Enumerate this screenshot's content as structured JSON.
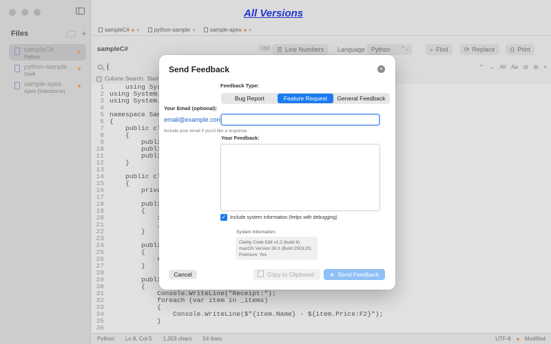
{
  "app": {
    "title": "All Versions"
  },
  "sidebar": {
    "header": "Files",
    "new_folder_icon": "folder-plus-icon",
    "add_icon": "+",
    "items": [
      {
        "name": "sampleC#",
        "lang": "Python",
        "modified": true,
        "active": true
      },
      {
        "name": "python-sample",
        "lang": "Swift",
        "modified": true,
        "active": false
      },
      {
        "name": "sample-apex",
        "lang": "Apex (Salesforce)",
        "modified": true,
        "active": false
      }
    ]
  },
  "tabs": [
    {
      "label": "sampleC#"
    },
    {
      "label": "python-sample"
    },
    {
      "label": "sample-apex"
    }
  ],
  "toolbar": {
    "document_name": "sampleC#",
    "font_size": "13pt",
    "line_numbers_label": "Line Numbers",
    "language_label": "Language",
    "language_value": "Python",
    "find_label": "Find",
    "replace_label": "Replace",
    "print_label": "Print"
  },
  "search": {
    "query": "{",
    "all_label": "All",
    "case_label": "Aa",
    "column_search_label": "Column Search:",
    "start_label": "Start:"
  },
  "code": [
    {
      "n": "1",
      "t": "    using Syst"
    },
    {
      "n": "2",
      "t": "using System.C"
    },
    {
      "n": "3",
      "t": "using System.L"
    },
    {
      "n": "4",
      "t": ""
    },
    {
      "n": "5",
      "t": "namespace Samp"
    },
    {
      "n": "6",
      "t": "{"
    },
    {
      "n": "7",
      "t": "    public cla"
    },
    {
      "n": "8",
      "t": "    {"
    },
    {
      "n": "9",
      "t": "        public"
    },
    {
      "n": "10",
      "t": "        public"
    },
    {
      "n": "11",
      "t": "        public"
    },
    {
      "n": "12",
      "t": "    }"
    },
    {
      "n": "13",
      "t": ""
    },
    {
      "n": "14",
      "t": "    public cla"
    },
    {
      "n": "15",
      "t": "    {"
    },
    {
      "n": "16",
      "t": "        privat"
    },
    {
      "n": "17",
      "t": ""
    },
    {
      "n": "18",
      "t": "        public"
    },
    {
      "n": "19",
      "t": "        {"
    },
    {
      "n": "20",
      "t": "            if"
    },
    {
      "n": "21",
      "t": "            _i"
    },
    {
      "n": "22",
      "t": "        }"
    },
    {
      "n": "23",
      "t": ""
    },
    {
      "n": "24",
      "t": "        public"
    },
    {
      "n": "25",
      "t": "        {"
    },
    {
      "n": "26",
      "t": "            re"
    },
    {
      "n": "27",
      "t": "        }"
    },
    {
      "n": "28",
      "t": ""
    },
    {
      "n": "29",
      "t": "        public"
    },
    {
      "n": "30",
      "t": "        {"
    },
    {
      "n": "31",
      "t": "            Console.WriteLine(\"Receipt:\");"
    },
    {
      "n": "32",
      "t": "            foreach (var item in _items)"
    },
    {
      "n": "33",
      "t": "            {"
    },
    {
      "n": "34",
      "t": "                Console.WriteLine($\"{item.Name} - ${item.Price:F2}\");"
    },
    {
      "n": "35",
      "t": "            }"
    },
    {
      "n": "36",
      "t": ""
    }
  ],
  "status": {
    "language": "Python",
    "position": "Ln 8, Col 5",
    "chars": "1,353 chars",
    "lines": "54 lines",
    "encoding": "UTF-8",
    "modified": "Modified"
  },
  "dialog": {
    "title": "Send Feedback",
    "feedback_type_label": "Feedback Type:",
    "types": [
      "Bug Report",
      "Feature Request",
      "General Feedback"
    ],
    "selected_type": "Feature Request",
    "email_label": "Your Email (optional):",
    "email_placeholder": "email@example.com",
    "email_value": "",
    "email_help": "Include your email if you'd like a response",
    "feedback_label": "Your Feedback:",
    "feedback_value": "",
    "include_sysinfo_label": "Include system information (helps with debugging)",
    "include_sysinfo_checked": true,
    "sysinfo_label": "System Information:",
    "sysinfo_lines": [
      "Clarity Code Edit v1.2 (build 8)",
      "macOS Version 26.3 (Build 25D125)",
      "Premium: Yes"
    ],
    "cancel_label": "Cancel",
    "copy_label": "Copy to Clipboard",
    "send_label": "Send Feedback"
  },
  "colors": {
    "accent": "#1a7cf0",
    "title_link": "#2233dd",
    "modified_dot": "#e6a266"
  }
}
